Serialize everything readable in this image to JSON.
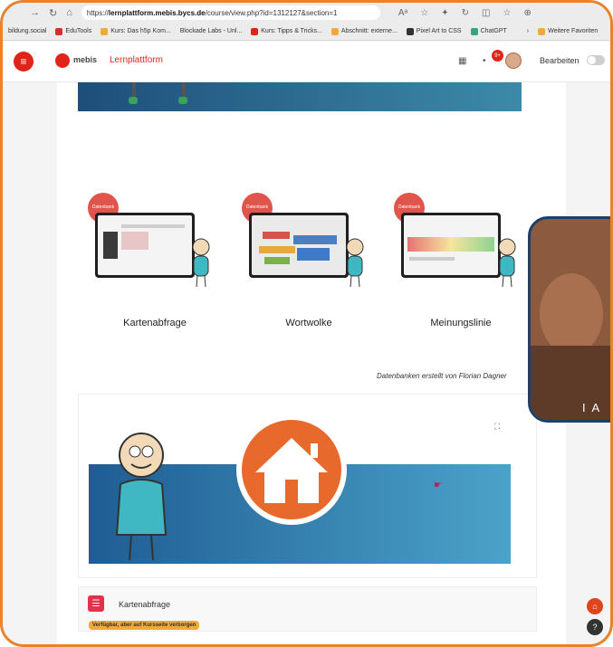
{
  "browser": {
    "url_prefix": "https://",
    "url_host": "lernplattform.mebis.bycs.de",
    "url_path": "/course/view.php?id=1312127&section=1",
    "bookmarks": [
      {
        "label": "bildung.social",
        "color": "#9a9a9a"
      },
      {
        "label": "EduTools",
        "color": "#d13030"
      },
      {
        "label": "Kurs: Das h5p Kom...",
        "color": "#f0a93a"
      },
      {
        "label": "Blockade Labs - Unl...",
        "color": "#9a9a9a"
      },
      {
        "label": "Kurs: Tipps & Tricks...",
        "color": "#e2231a"
      },
      {
        "label": "Abschnitt: externe...",
        "color": "#f0a93a"
      },
      {
        "label": "Pixel Art to CSS",
        "color": "#333333"
      },
      {
        "label": "ChatGPT",
        "color": "#3aa37a"
      },
      {
        "label": "Weitere Favoriten",
        "color": "#f0a93a"
      }
    ]
  },
  "header": {
    "brand": "mebis",
    "platform": "Lernplattform",
    "notifications_count": "9+",
    "edit_label": "Bearbeiten"
  },
  "tiles": [
    {
      "label": "Kartenabfrage",
      "badge": "Datenbank"
    },
    {
      "label": "Wortwolke",
      "badge": "Datenbank"
    },
    {
      "label": "Meinungslinie",
      "badge": "Datenbank"
    }
  ],
  "credit": "Datenbanken erstellt von Florian Dagner",
  "video": {
    "caption": "I A"
  },
  "activity": {
    "label": "Kartenabfrage",
    "availability": "Verfügbar, aber auf Kursseite verborgen"
  },
  "colors": {
    "accent": "#e2231a",
    "frame": "#e8822c",
    "banner": "#2a6e9e"
  }
}
